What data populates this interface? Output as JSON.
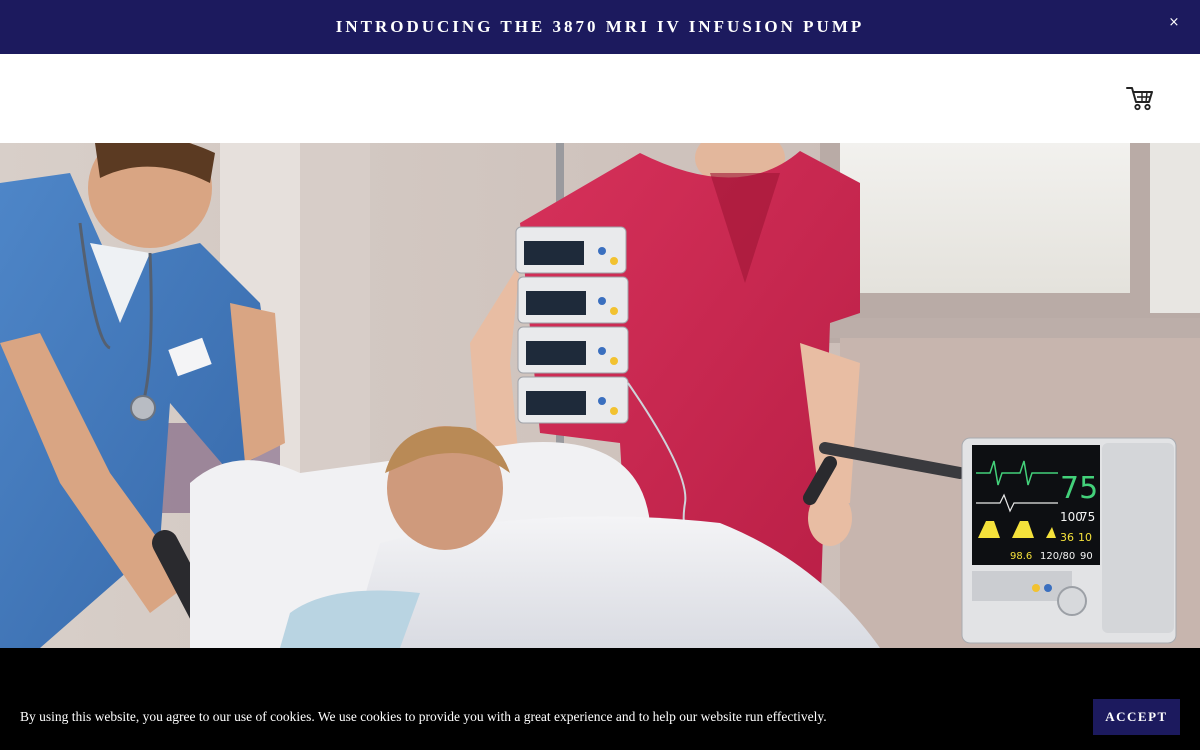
{
  "announcement": {
    "text": "INTRODUCING THE 3870 MRI IV INFUSION PUMP",
    "close_label": "×"
  },
  "header": {
    "cart_icon": "shopping-cart-icon"
  },
  "hero": {
    "monitor": {
      "heart_rate": "75",
      "spo2": "100",
      "pulse": "75",
      "resp": "10",
      "bp": "120/80",
      "temp": "98.6",
      "extra": "90",
      "small": "36"
    }
  },
  "cookie": {
    "message": "By using this website, you agree to our use of cookies. We use cookies to provide you with a great experience and to help our website run effectively.",
    "accept_label": "ACCEPT"
  },
  "colors": {
    "brand": "#1c1a5e",
    "cookie_bg": "#000000"
  }
}
